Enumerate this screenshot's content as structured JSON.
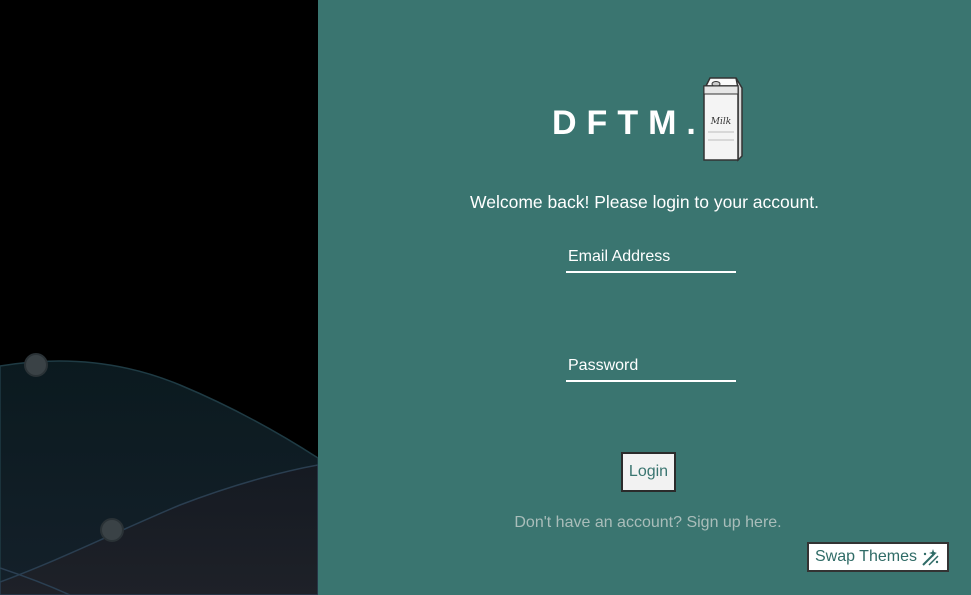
{
  "brand": {
    "name": "DFTM.",
    "logo_icon": "milk-carton-icon",
    "logo_text": "Milk"
  },
  "welcome_message": "Welcome back! Please login to your account.",
  "form": {
    "email_placeholder": "Email Address",
    "email_value": "",
    "password_placeholder": "Password",
    "password_value": "",
    "login_label": "Login"
  },
  "signup_text": "Don't have an account? Sign up here.",
  "theme_button": {
    "label": "Swap Themes",
    "icon": "magic-wand-icon"
  },
  "colors": {
    "panel_background": "#3a7570",
    "left_background": "#000000",
    "text": "#ffffff",
    "link": "#a9bdba"
  }
}
